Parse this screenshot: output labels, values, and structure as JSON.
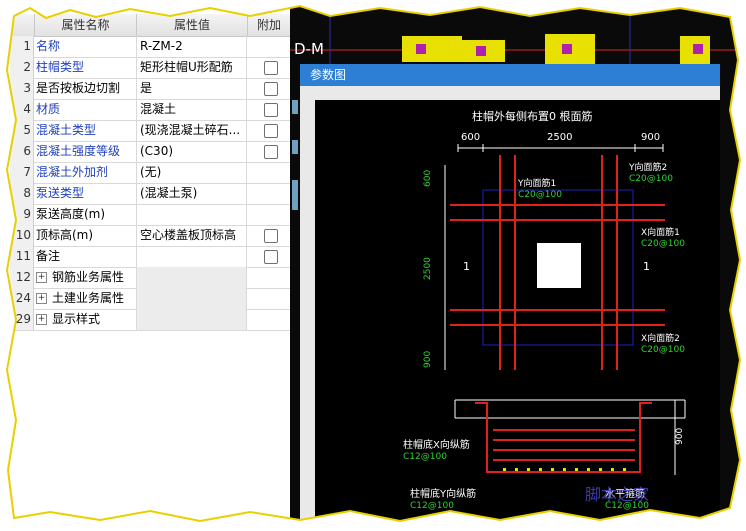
{
  "grid": {
    "headers": {
      "name": "属性名称",
      "value": "属性值",
      "add": "附加"
    },
    "rows": [
      {
        "num": "1",
        "name": "名称",
        "value": "R-ZM-2",
        "blue": true,
        "checkbox": false
      },
      {
        "num": "2",
        "name": "柱帽类型",
        "value": "矩形柱帽U形配筋",
        "blue": true,
        "checkbox": true
      },
      {
        "num": "3",
        "name": "是否按板边切割",
        "value": "是",
        "blue": false,
        "checkbox": true
      },
      {
        "num": "4",
        "name": "材质",
        "value": "混凝土",
        "blue": true,
        "checkbox": true
      },
      {
        "num": "5",
        "name": "混凝土类型",
        "value": "(现浇混凝土碎石...",
        "blue": true,
        "checkbox": true
      },
      {
        "num": "6",
        "name": "混凝土强度等级",
        "value": "(C30)",
        "blue": true,
        "checkbox": true
      },
      {
        "num": "7",
        "name": "混凝土外加剂",
        "value": "(无)",
        "blue": true,
        "checkbox": false
      },
      {
        "num": "8",
        "name": "泵送类型",
        "value": "(混凝土泵)",
        "blue": true,
        "checkbox": false
      },
      {
        "num": "9",
        "name": "泵送高度(m)",
        "value": "",
        "blue": false,
        "checkbox": false
      },
      {
        "num": "10",
        "name": "顶标高(m)",
        "value": "空心楼盖板顶标高",
        "blue": false,
        "checkbox": true
      },
      {
        "num": "11",
        "name": "备注",
        "value": "",
        "blue": false,
        "checkbox": true
      }
    ],
    "groups": [
      {
        "num": "12",
        "name": "钢筋业务属性",
        "expand": "+"
      },
      {
        "num": "24",
        "name": "土建业务属性",
        "expand": "+"
      },
      {
        "num": "29",
        "name": "显示样式",
        "expand": "+"
      }
    ]
  },
  "cad_bg_label": "D-M",
  "dialog": {
    "title": "参数图",
    "drawing": {
      "plan_title": "柱帽外每侧布置0 根面筋",
      "dims_top": [
        "600",
        "2500",
        "900"
      ],
      "dims_left": [
        "600",
        "2500",
        "900"
      ],
      "section_marks": [
        "1",
        "1"
      ],
      "labels": {
        "y_face1": "Y向面筋1",
        "y_face1_val": "C20@100",
        "y_face2": "Y向面筋2",
        "y_face2_val": "C20@100",
        "x_face1": "X向面筋1",
        "x_face1_val": "C20@100",
        "x_face2": "X向面筋2",
        "x_face2_val": "C20@100",
        "bottom_x": "柱帽底X向纵筋",
        "bottom_x_val": "C12@100",
        "bottom_y": "柱帽底Y向纵筋",
        "bottom_y_val": "C12@100",
        "stirrup": "水平箍筋",
        "stirrup_val": "C12@100",
        "section_dim": "900"
      }
    }
  },
  "watermark": "脚本之家",
  "colors": {
    "red": "#e0201c",
    "green": "#30d030",
    "blue": "#2020c0",
    "yellow": "#e8e000",
    "title_bar": "#2d7fd6"
  }
}
